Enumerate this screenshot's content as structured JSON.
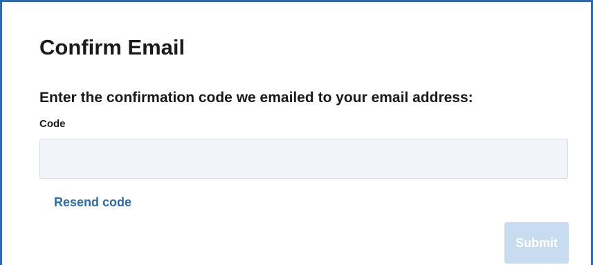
{
  "form": {
    "title": "Confirm Email",
    "instruction": "Enter the confirmation code we emailed to your email address:",
    "code_field": {
      "label": "Code",
      "value": "",
      "placeholder": ""
    },
    "resend_label": "Resend code",
    "submit_label": "Submit",
    "submit_state": "disabled"
  },
  "colors": {
    "accent": "#2b6cb0",
    "submit_disabled_bg": "#c7ddef",
    "input_bg": "#f3f4f9",
    "text": "#1a1a1a"
  }
}
